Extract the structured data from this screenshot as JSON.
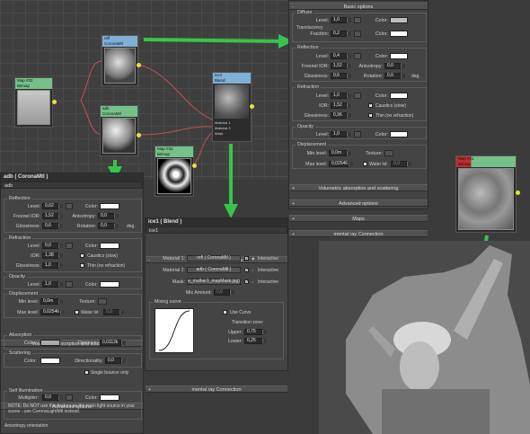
{
  "colors": {
    "accent_green": "#37c44a",
    "node_blue": "#7fb0d8",
    "node_green": "#76c08a",
    "node_red": "#c03030"
  },
  "icons": [
    "plus-minus-icon",
    "map-button-icon",
    "checkbox-icon",
    "arrow-icon"
  ],
  "nodes": {
    "map_fallout": {
      "title": "Map #32",
      "subtitle": "Bitmap"
    },
    "refl": {
      "title": "refl",
      "subtitle": "CoronaMtl"
    },
    "adb": {
      "title": "adb",
      "subtitle": "CoronaMtl"
    },
    "blend": {
      "title": "ice1",
      "subtitle": "Blend",
      "ports": [
        "Material 1",
        "Material 2",
        "Mask"
      ]
    },
    "mask": {
      "title": "Map #33",
      "subtitle": "Bitmap"
    },
    "photo": {
      "title": "Map #31",
      "subtitle": "Bitmap"
    }
  },
  "adb_panel": {
    "title": "adb  ( CoronaMtl )",
    "name": "adb",
    "reflection": {
      "label": "Reflection",
      "level_label": "Level:",
      "level": "0,62",
      "color_label": "Color:",
      "fresnel_label": "Fresnel IOR:",
      "fresnel": "1,52",
      "aniso_label": "Anisotropy:",
      "aniso": "0,0",
      "gloss_label": "Glossiness:",
      "gloss": "0,6",
      "rot_label": "Rotation:",
      "rot": "0,0",
      "deg": "deg."
    },
    "refraction": {
      "label": "Refraction",
      "level_label": "Level:",
      "level": "0,0",
      "color_label": "Color:",
      "ior_label": "IOR:",
      "ior": "1,38",
      "caustics": "Caustics (slow)",
      "gloss_label": "Glossiness:",
      "gloss": "1,0",
      "thin": "Thin (no refraction)"
    },
    "opacity": {
      "label": "Opacity",
      "level_label": "Level:",
      "level": "1,0",
      "color_label": "Color:"
    },
    "displacement": {
      "label": "Displacement",
      "min_label": "Min level:",
      "min": "0,0m",
      "texture_label": "Texture:",
      "max_label": "Max level:",
      "max": "0,02546",
      "water": "Water lvl:",
      "water_val": "0,0"
    },
    "vol_roll": "Volumetric absorption and scattering",
    "absorption": {
      "label": "Absorption",
      "color_label": "Color:",
      "dist_label": "Distance:",
      "dist": "0,0112k"
    },
    "scattering": {
      "label": "Scattering",
      "color_label": "Color:",
      "dir_label": "Directionality:",
      "dir": "0,0"
    },
    "single_bounce": "Single bounce only",
    "adv_roll": "Advanced options",
    "self_illum": {
      "label": "Self Illumination",
      "mult_label": "Multiplier:",
      "mult": "0,0",
      "color_label": "Color:",
      "note": "NOTE: Do NOT use this feature as the main light source in your scene - use CoronaLightMtl instead."
    },
    "aniso_orient": "Anisotropy orientation"
  },
  "basic_panel": {
    "roll": "Basic options",
    "diffuse": {
      "label": "Diffuse",
      "level_label": "Level:",
      "level": "1,0",
      "color_label": "Color:",
      "transl_label": "Translucency",
      "fraction_label": "Fraction:",
      "fraction": "0,2",
      "t_color_label": "Color:"
    },
    "reflection": {
      "label": "Reflection",
      "level_label": "Level:",
      "level": "0,4",
      "color_label": "Color:",
      "fresnel_label": "Fresnel IOR:",
      "fresnel": "1,52",
      "aniso_label": "Anisotropy:",
      "aniso": "0,0",
      "gloss_label": "Glossiness:",
      "gloss": "0,6",
      "rot_label": "Rotation:",
      "rot": "0,0",
      "deg": "deg."
    },
    "refraction": {
      "label": "Refraction",
      "level_label": "Level:",
      "level": "1,0",
      "color_label": "Color:",
      "ior_label": "IOR:",
      "ior": "1,52",
      "caustics": "Caustics (slow)",
      "gloss_label": "Glossiness:",
      "gloss": "0,96",
      "thin": "Thin (no refraction)"
    },
    "opacity": {
      "label": "Opacity",
      "level_label": "Level:",
      "level": "1,0",
      "color_label": "Color:"
    },
    "displacement": {
      "label": "Displacement",
      "min_label": "Min level:",
      "min": "0,0m",
      "texture_label": "Texture:",
      "max_label": "Max level:",
      "max": "0,02546",
      "water": "Water lvl:",
      "water_val": "0,0"
    },
    "rolls": [
      "Volumetric absorption and scattering",
      "Advanced options",
      "Maps",
      "mental ray Connection"
    ]
  },
  "blend_panel": {
    "title": "ice1  ( Blend )",
    "name": "ice1",
    "roll": "Blend Basic Parameters",
    "m1_label": "Material 1:",
    "m1": "refl  ( CoronaMtl )",
    "m2_label": "Material 2:",
    "m2": "adb  ( CoronaMtl )",
    "mask_label": "Mask:",
    "mask": "e_mulher1_mapMask.jpg)",
    "interactive": "Interactive",
    "mix_label": "Mix Amount:",
    "mix": "0,0",
    "curve_label": "Mixing curve",
    "use_curve": "Use Curve",
    "transition": "Transition zone:",
    "upper_label": "Upper:",
    "upper": "0,75",
    "lower_label": "Lower:",
    "lower": "0,25",
    "mr_roll": "mental ray Connection"
  }
}
